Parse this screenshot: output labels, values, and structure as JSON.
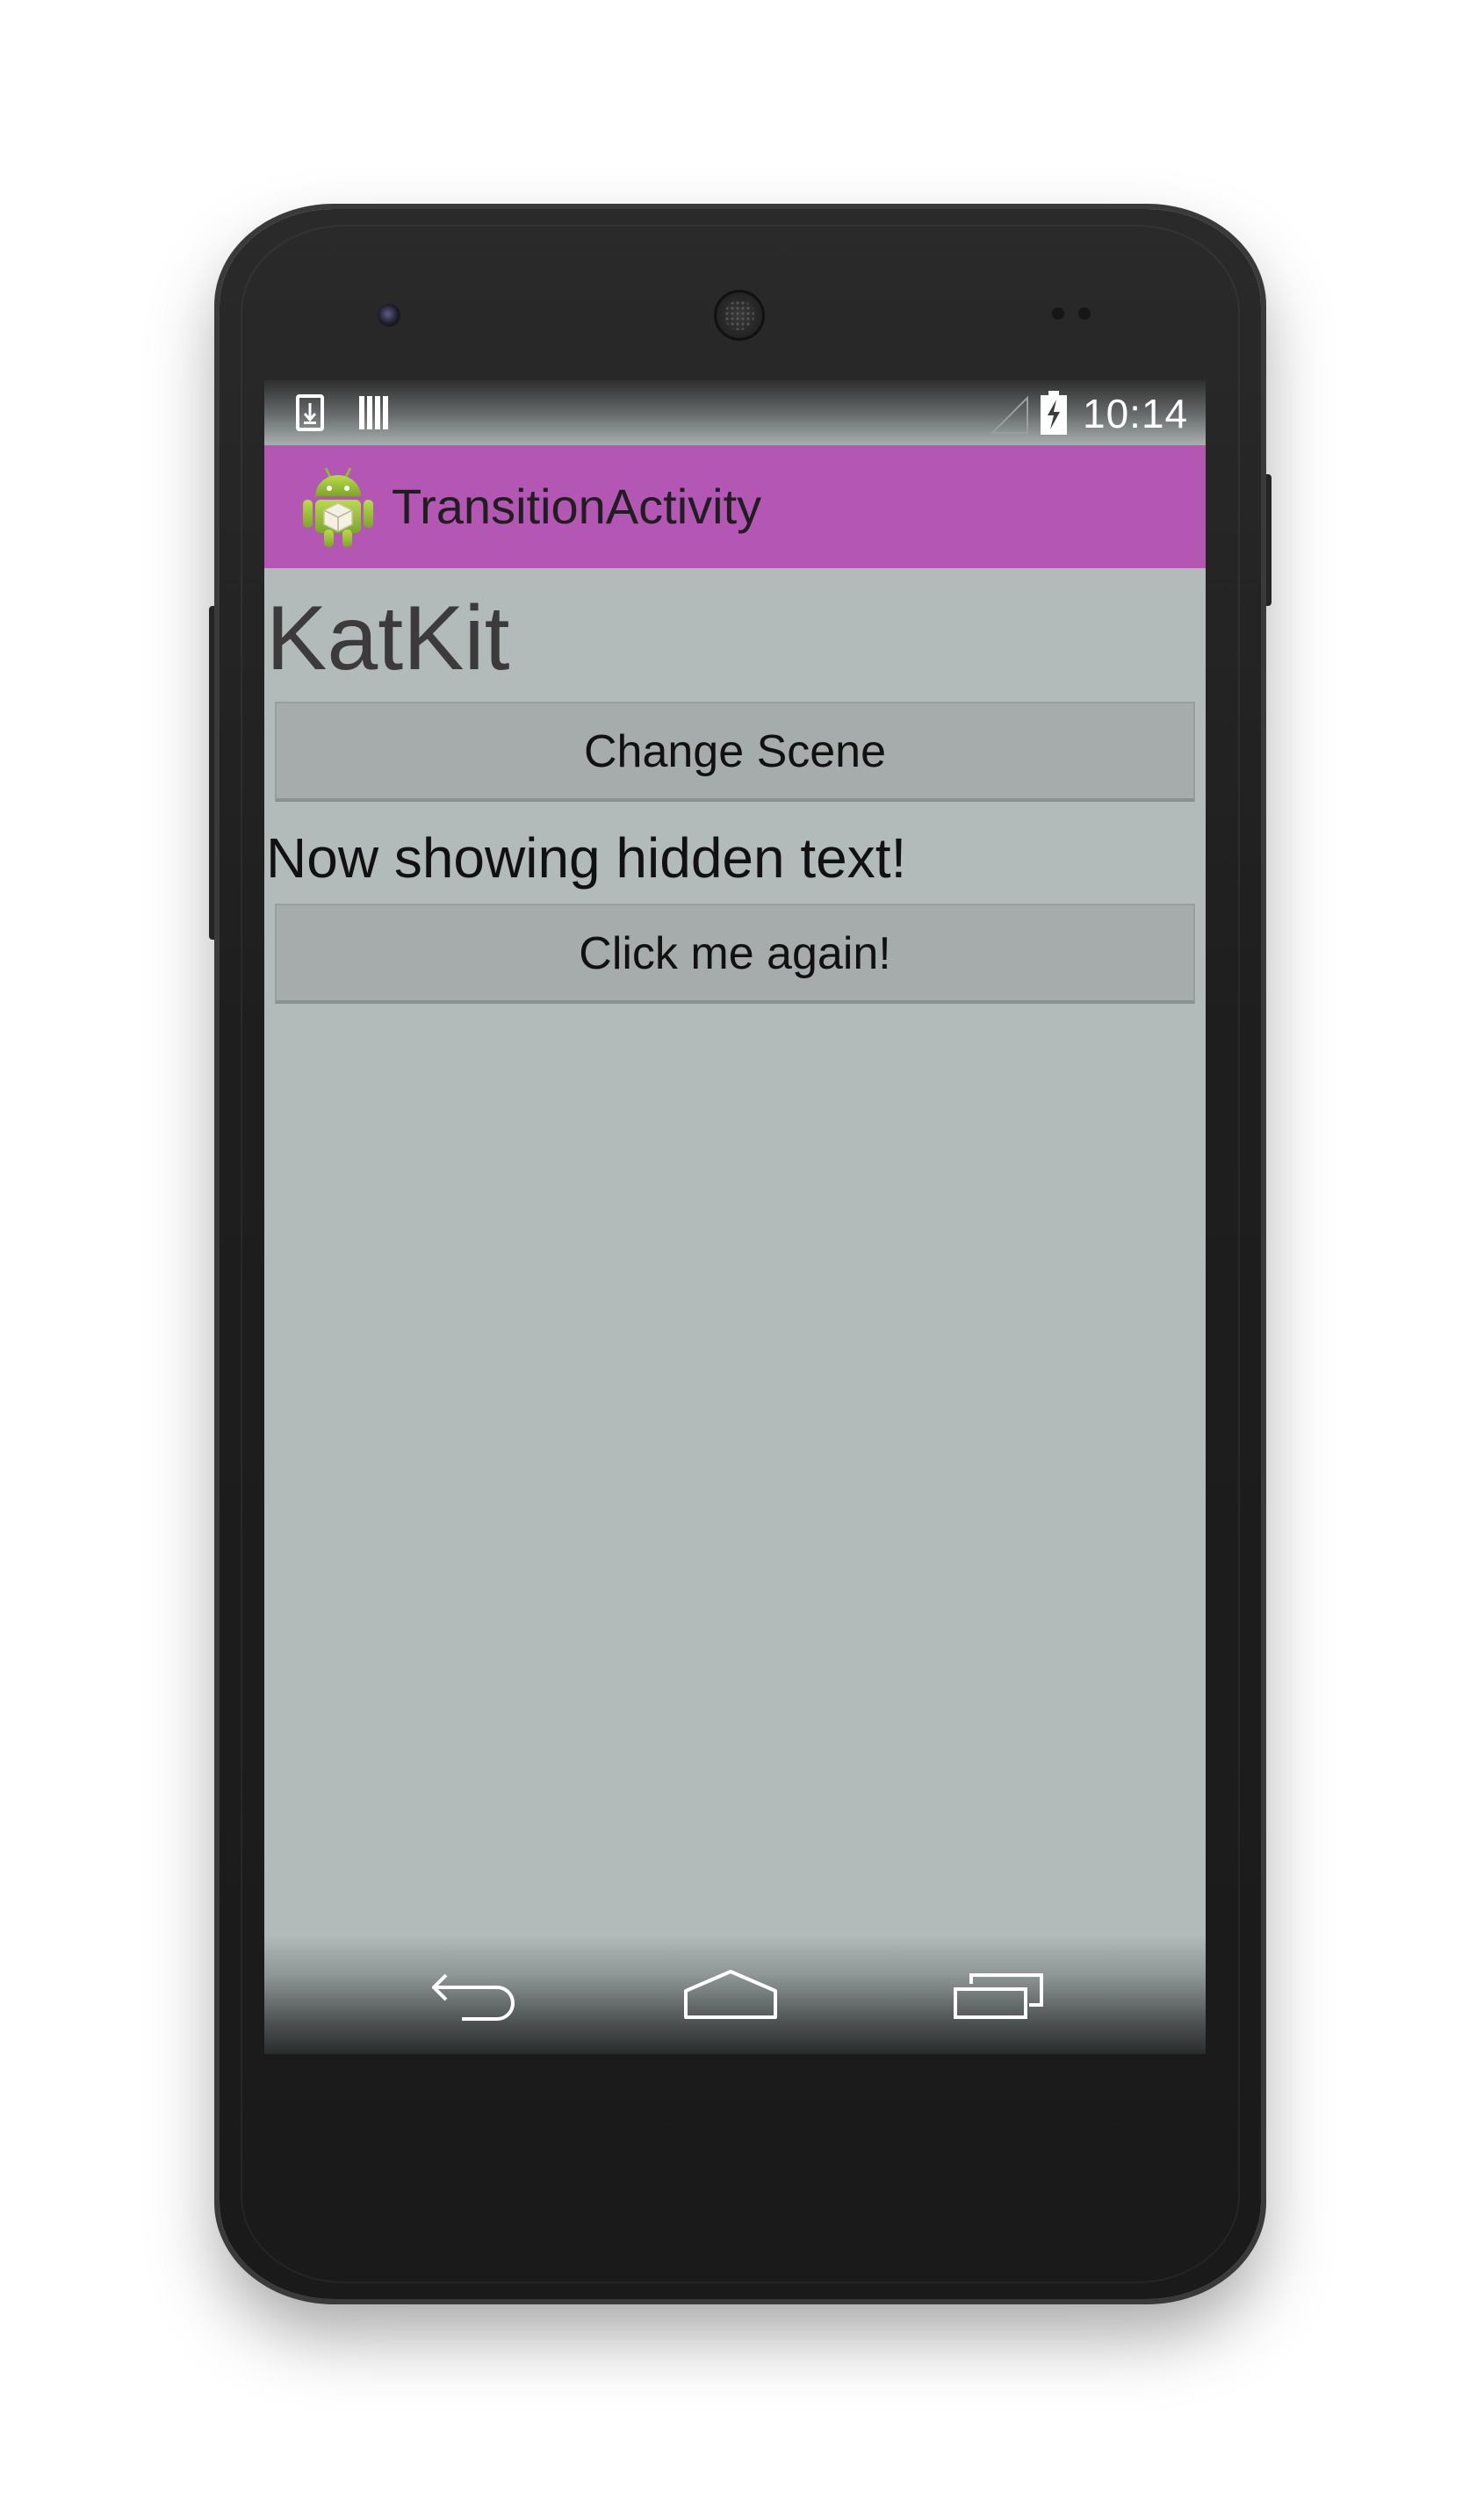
{
  "status_bar": {
    "time": "10:14",
    "icons": [
      "download-icon",
      "storage-icon",
      "signal-icon",
      "battery-charging-icon"
    ]
  },
  "action_bar": {
    "title": "TransitionActivity",
    "icon": "android-app-icon",
    "color": "#b456b3"
  },
  "content": {
    "headline": "KatKit",
    "change_scene_label": "Change Scene",
    "hidden_text": "Now showing hidden text!",
    "click_again_label": "Click me again!",
    "background_color": "#b3bbba"
  },
  "nav_bar": {
    "icons": [
      "back-icon",
      "home-icon",
      "recent-apps-icon"
    ]
  }
}
